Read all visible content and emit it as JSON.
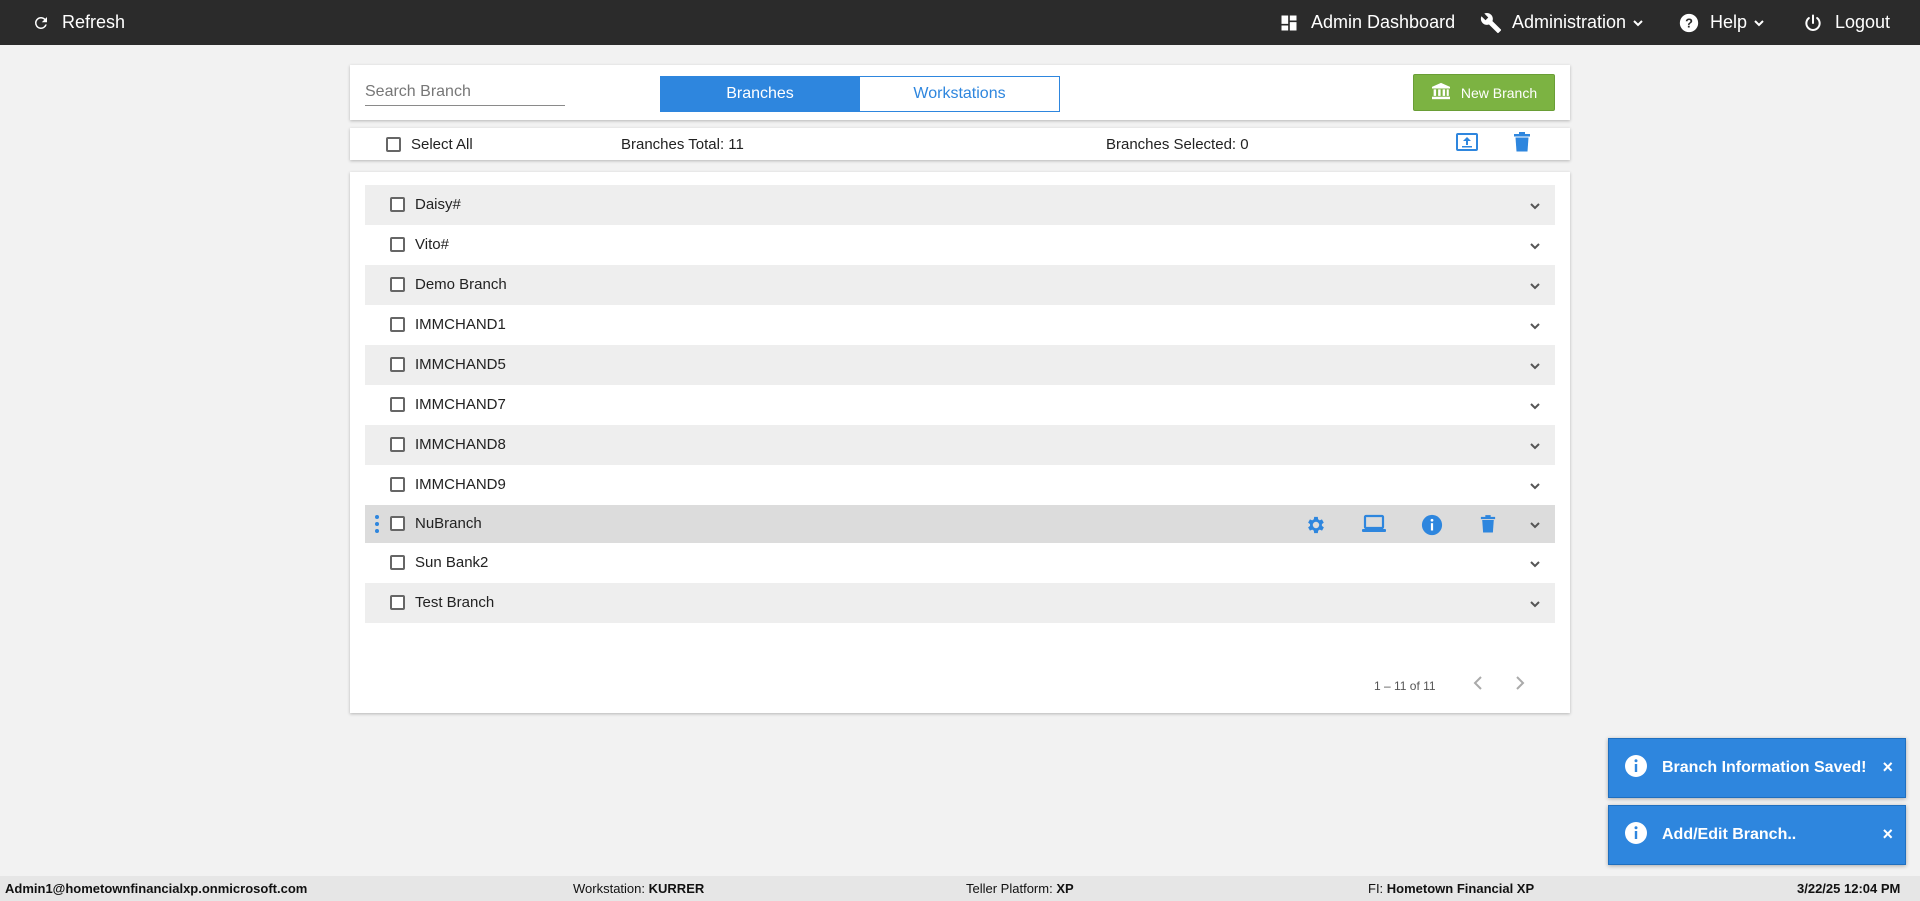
{
  "topbar": {
    "refresh_label": "Refresh",
    "admin_dashboard_label": "Admin Dashboard",
    "administration_label": "Administration",
    "help_label": "Help",
    "logout_label": "Logout"
  },
  "toolbar": {
    "search_placeholder": "Search Branch",
    "tabs": [
      {
        "label": "Branches",
        "active": true
      },
      {
        "label": "Workstations",
        "active": false
      }
    ],
    "new_branch_label": "New Branch"
  },
  "info_bar": {
    "select_all_label": "Select All",
    "total_text": "Branches Total: 11",
    "selected_text": "Branches Selected: 0"
  },
  "branches": [
    "Daisy#",
    "Vito#",
    "Demo Branch",
    "IMMCHAND1",
    "IMMCHAND5",
    "IMMCHAND7",
    "IMMCHAND8",
    "IMMCHAND9",
    "NuBranch",
    "Sun Bank2",
    "Test Branch"
  ],
  "pagination": {
    "range_text": "1 – 11 of 11"
  },
  "toasts": [
    {
      "message": "Branch Information Saved!",
      "close": "×"
    },
    {
      "message": "Add/Edit Branch..",
      "close": "×"
    }
  ],
  "footer": {
    "user": "Admin1@hometownfinancialxp.onmicrosoft.com",
    "workstation_label": "Workstation:",
    "workstation_value": "KURRER",
    "teller_platform_label": "Teller Platform:",
    "teller_platform_value": "XP",
    "fi_label": "FI:",
    "fi_value": "Hometown Financial XP",
    "datetime": "3/22/25 12:04 PM"
  },
  "colors": {
    "accent": "#2e86de",
    "topbar": "#2b2b2b",
    "new_branch_button": "#7cb342"
  }
}
